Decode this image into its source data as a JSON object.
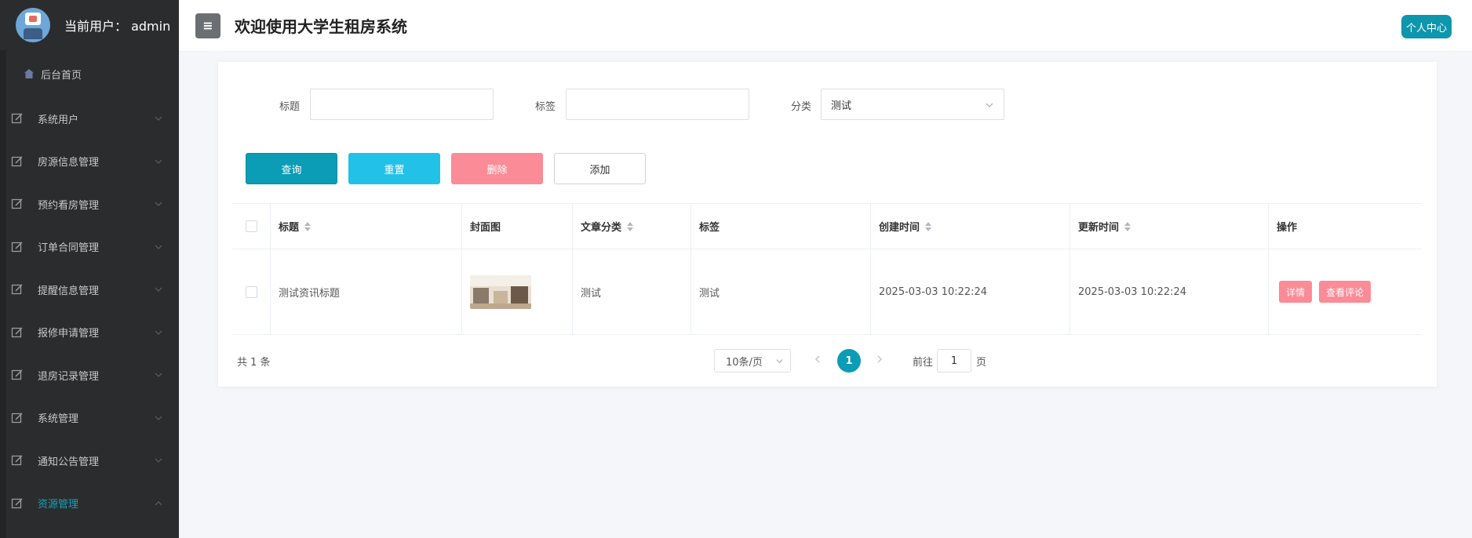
{
  "sidebar": {
    "user_label": "当前用户：  admin",
    "home_label": "后台首页",
    "items": [
      {
        "label": "系统用户",
        "expanded": false
      },
      {
        "label": "房源信息管理",
        "expanded": false
      },
      {
        "label": "预约看房管理",
        "expanded": false
      },
      {
        "label": "订单合同管理",
        "expanded": false
      },
      {
        "label": "提醒信息管理",
        "expanded": false
      },
      {
        "label": "报修申请管理",
        "expanded": false
      },
      {
        "label": "退房记录管理",
        "expanded": false
      },
      {
        "label": "系统管理",
        "expanded": false
      },
      {
        "label": "通知公告管理",
        "expanded": false
      },
      {
        "label": "资源管理",
        "expanded": true,
        "active": true
      }
    ],
    "active_color": "#14a3b8"
  },
  "header": {
    "toggle_icon": "≡",
    "title": "欢迎使用大学生租房系统",
    "profile_label": "个人中心"
  },
  "filters": {
    "title_label": "标题",
    "title_value": "",
    "tag_label": "标签",
    "tag_value": "",
    "category_label": "分类",
    "category_value": "测试"
  },
  "actions": {
    "search": "查询",
    "reset": "重置",
    "delete": "删除",
    "add": "添加"
  },
  "table": {
    "columns": [
      "标题",
      "封面图",
      "文章分类",
      "标签",
      "创建时间",
      "更新时间",
      "操作"
    ],
    "rows": [
      {
        "title": "测试资讯标题",
        "category": "测试",
        "tag": "测试",
        "created": "2025-03-03 10:22:24",
        "updated": "2025-03-03 10:22:24",
        "ops": [
          "详情",
          "查看评论"
        ]
      }
    ]
  },
  "pagination": {
    "total": "共 1 条",
    "page_size": "10条/页",
    "current_page": "1",
    "goto_label": "前往",
    "goto_value": "1",
    "goto_unit": "页"
  },
  "colors": {
    "primary": "#0a9db5",
    "reset": "#22c1e8",
    "danger": "#fb8b96",
    "sidebar_bg": "#2b2c2e"
  }
}
